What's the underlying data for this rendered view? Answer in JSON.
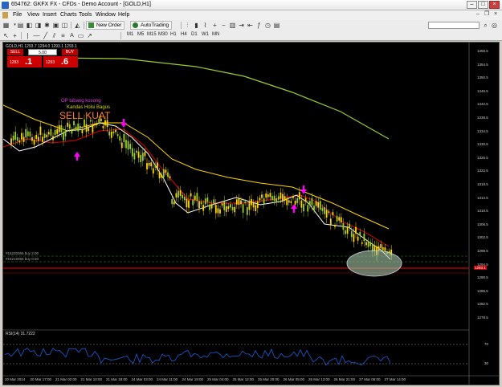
{
  "window": {
    "title": "654762: GKFX FX - CFDs - Demo Account - [GOLD,H1]"
  },
  "menu": [
    "File",
    "View",
    "Insert",
    "Charts",
    "Tools",
    "Window",
    "Help"
  ],
  "toolbar": {
    "new_order": "New Order",
    "autotrading": "AutoTrading"
  },
  "timeframes": [
    "M1",
    "M5",
    "M15",
    "M30",
    "H1",
    "H4",
    "D1",
    "W1",
    "MN"
  ],
  "chart": {
    "symbol_line": "GOLD,H1  1293.7 1294.0 1293.1 1293.1",
    "trade": {
      "sell": "SELL",
      "buy": "BUY",
      "lot": "5.00",
      "sell_small": "1293",
      "sell_big": ".1",
      "buy_small": "1293",
      "buy_big": ".6"
    },
    "annotations": [
      "OP tubang kosong",
      "Kandas Holsi Bagus",
      "SELL KUAT"
    ],
    "pending": [
      "#15220365 buy 2.00",
      "#15219356 buy 0.50"
    ],
    "rsi_label": "RSI(14) 31.7222",
    "price_tag": "1293.1",
    "price_axis": [
      "1358.5",
      "1354.5",
      "1350.5",
      "1346.5",
      "1342.5",
      "1338.5",
      "1334.5",
      "1330.5",
      "1326.5",
      "1322.5",
      "1318.5",
      "1314.5",
      "1310.5",
      "1306.5",
      "1302.5",
      "1298.5",
      "1294.5",
      "1290.5",
      "1286.5",
      "1282.5",
      "1278.5"
    ],
    "rsi_axis": [
      "70",
      "30"
    ],
    "time_axis": [
      "20 Mar 2014",
      "20 Mar 17:00",
      "21 Mar 02:00",
      "21 Mar 10:00",
      "21 Mar 18:00",
      "24 Mar 03:00",
      "24 Mar 11:00",
      "24 Mar 19:00",
      "25 Mar 04:00",
      "25 Mar 12:00",
      "25 Mar 20:00",
      "26 Mar 05:00",
      "26 Mar 13:00",
      "26 Mar 21:00",
      "27 Mar 06:00",
      "27 Mar 14:00"
    ]
  },
  "colors": {
    "sma_long": "#9acd32",
    "ema_mid": "#ffd700",
    "ema_fast": "#e00000",
    "price_line": "#ffffff",
    "bull": "#9acd32",
    "bear": "#ffd700",
    "arrow": "#ff00ff",
    "ellipse": "#a8c8a8",
    "rsi": "#1e5fd8"
  }
}
